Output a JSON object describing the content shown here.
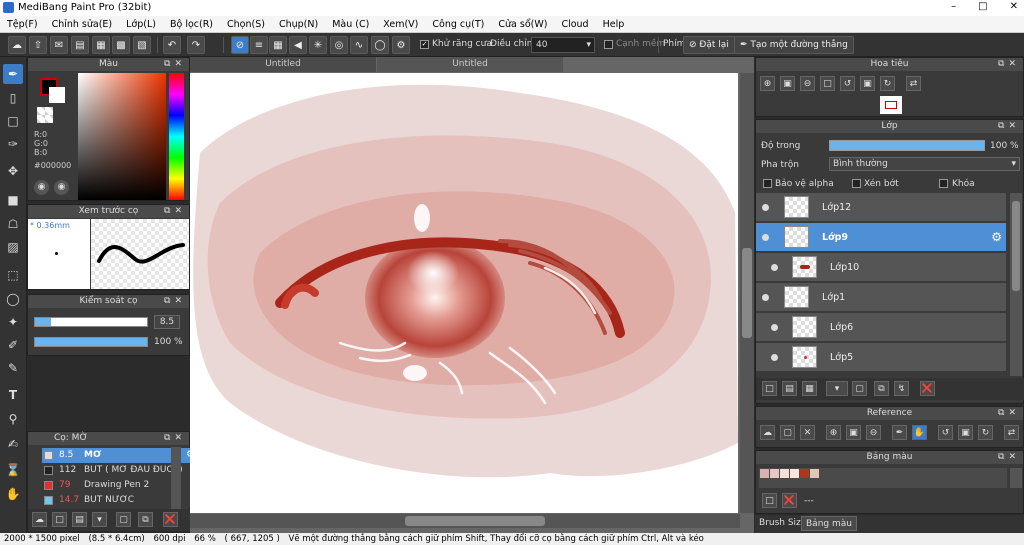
{
  "app": {
    "title": "MediBang Paint Pro (32bit)"
  },
  "menu": [
    "Tệp(F)",
    "Chỉnh sửa(E)",
    "Lớp(L)",
    "Bộ lọc(R)",
    "Chọn(S)",
    "Chụp(N)",
    "Màu (C)",
    "Xem(V)",
    "Công cụ(T)",
    "Cửa sổ(W)",
    "Cloud",
    "Help"
  ],
  "toolbar": {
    "antialias_label": "Khử răng cưa",
    "adjust_label": "Điều chỉnh",
    "adjust_value": "40",
    "crop_label": "Cạnh mềm",
    "key_label": "Phím",
    "reset_label": "Đặt lại",
    "straight_line_label": "Tạo một đường thẳng"
  },
  "color_panel": {
    "title": "Màu",
    "r": "R:0",
    "g": "G:0",
    "b": "B:0",
    "hex": "#000000",
    "primary": "#000000",
    "accent": "#cc0000"
  },
  "brush_preview": {
    "title": "Xem trước cọ",
    "size": "* 0.36mm"
  },
  "brush_control": {
    "title": "Kiểm soát cọ",
    "size": "8.5",
    "opacity": "100 %"
  },
  "brush_list": {
    "title": "Cọ: MỜ",
    "items": [
      {
        "size": "8.5",
        "name": "MỜ",
        "color": "#dddddd"
      },
      {
        "size": "112",
        "name": "BÚT ( MỜ ĐẦU ĐUÔI )",
        "color": "#222222"
      },
      {
        "size": "79",
        "name": "Drawing Pen 2",
        "color": "#e03030"
      },
      {
        "size": "14.7",
        "name": "BÚT NƯỚC",
        "color": "#66ccee"
      }
    ]
  },
  "documents": {
    "tabs": [
      "Untitled",
      "Untitled"
    ]
  },
  "navigator": {
    "title": "Hoa tiêu"
  },
  "layer_panel": {
    "title": "Lớp",
    "opacity_label": "Độ trong",
    "opacity_value": "100 %",
    "blend_label": "Pha trộn",
    "blend_value": "Bình thường",
    "protect_alpha": "Bảo vệ alpha",
    "clipping": "Xén bớt",
    "lock": "Khóa",
    "layers": [
      "Lớp12",
      "Lớp9",
      "Lớp10",
      "Lớp1",
      "Lớp6",
      "Lớp5"
    ]
  },
  "reference_panel": {
    "title": "Reference"
  },
  "palette_panel": {
    "title": "Bảng màu",
    "separator": "---",
    "swatches": [
      "#d8b3b0",
      "#e7c8c3",
      "#f3e0d8",
      "#fde3d8",
      "#b03520",
      "#e5c5b8"
    ]
  },
  "bottom_tabs": [
    "Brush Size",
    "Bảng màu"
  ],
  "status": {
    "size": "2000 * 1500 pixel",
    "physical": "(8.5 * 6.4cm)",
    "dpi": "600 dpi",
    "zoom": "66 %",
    "coords": "( 667, 1205 )",
    "hint": "Vẽ một đường thẳng bằng cách giữ phím Shift, Thay đổi cỡ cọ bằng cách giữ phím Ctrl, Alt và kéo"
  }
}
